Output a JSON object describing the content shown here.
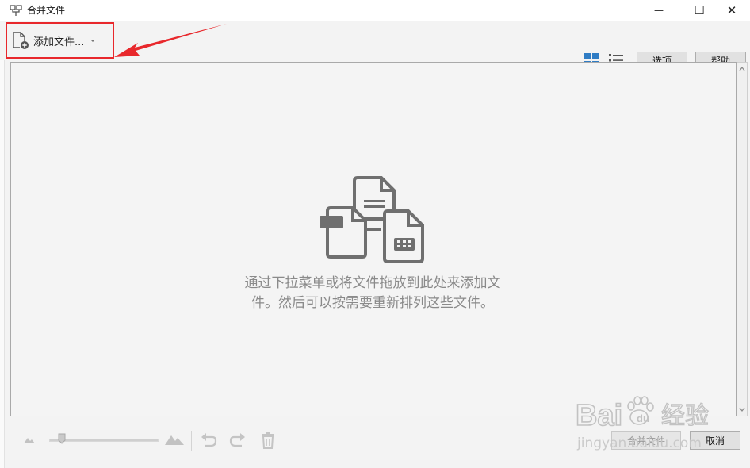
{
  "window": {
    "title": "合并文件",
    "minimize_glyph": "—",
    "maximize_glyph": "☐",
    "close_glyph": "✕"
  },
  "toolbar": {
    "add_file_label": "添加文件...",
    "options_label": "选项",
    "help_label": "帮助"
  },
  "drop_area": {
    "empty_message_line1": "通过下拉菜单或将文件拖放到此处来添加文",
    "empty_message_line2": "件。然后可以按需要重新排列这些文件。"
  },
  "footer": {
    "zoom_level": 0.1,
    "merge_label": "合并文件",
    "cancel_label": "取消"
  },
  "colors": {
    "accent_blue": "#2f7cc4",
    "annotation_red": "#e8282c",
    "icon_gray": "#6f6f6f"
  },
  "watermark": {
    "brand": "Bai",
    "brand_suffix": "du",
    "cn_text": "经验",
    "url": "jingyan.baidu.com"
  }
}
